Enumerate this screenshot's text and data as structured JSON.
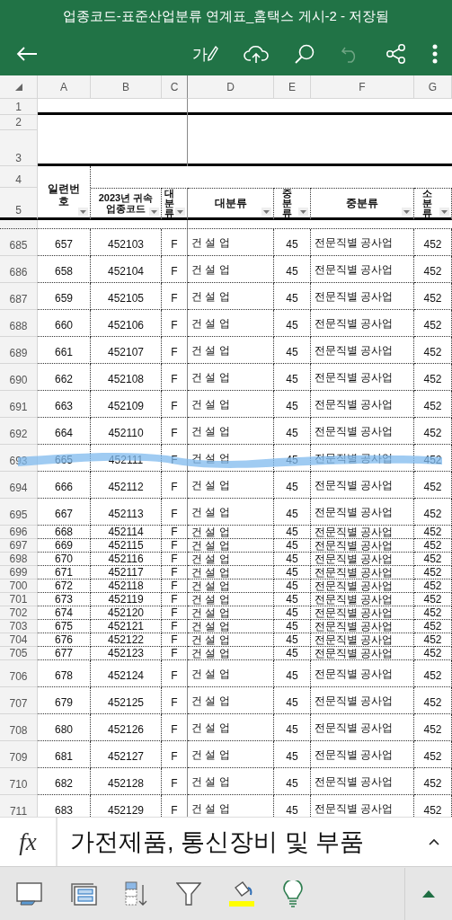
{
  "window": {
    "title": "업종코드-표준산업분류 연계표_홈택스 게시-2 - 저장됨"
  },
  "toolbar": {
    "ink_label": "가",
    "undo_disabled": true
  },
  "columns": [
    "A",
    "B",
    "C",
    "D",
    "E",
    "F",
    "G"
  ],
  "top_rows": [
    "1",
    "2",
    "3"
  ],
  "header_rows": [
    "4",
    "5"
  ],
  "table_headers": [
    {
      "label": "일련번호",
      "kind": "wrap"
    },
    {
      "label": "2023년 귀속 업종코드",
      "kind": "wrap"
    },
    {
      "label": "대분류",
      "kind": "vertical"
    },
    {
      "label": "대분류",
      "kind": "wrap"
    },
    {
      "label": "중분류",
      "kind": "vertical"
    },
    {
      "label": "중분류",
      "kind": "wrap"
    },
    {
      "label": "소분류",
      "kind": "vertical"
    }
  ],
  "rows": [
    {
      "row": "685",
      "kind": "tall",
      "ink_highlight": false,
      "cells": [
        "657",
        "452103",
        "F",
        "건 설 업",
        "45",
        "전문직별 공사업",
        "452"
      ]
    },
    {
      "row": "686",
      "kind": "tall",
      "ink_highlight": false,
      "cells": [
        "658",
        "452104",
        "F",
        "건 설 업",
        "45",
        "전문직별 공사업",
        "452"
      ]
    },
    {
      "row": "687",
      "kind": "tall",
      "ink_highlight": false,
      "cells": [
        "659",
        "452105",
        "F",
        "건 설 업",
        "45",
        "전문직별 공사업",
        "452"
      ]
    },
    {
      "row": "688",
      "kind": "tall",
      "ink_highlight": false,
      "cells": [
        "660",
        "452106",
        "F",
        "건 설 업",
        "45",
        "전문직별 공사업",
        "452"
      ]
    },
    {
      "row": "689",
      "kind": "tall",
      "ink_highlight": false,
      "cells": [
        "661",
        "452107",
        "F",
        "건 설 업",
        "45",
        "전문직별 공사업",
        "452"
      ]
    },
    {
      "row": "690",
      "kind": "tall",
      "ink_highlight": false,
      "cells": [
        "662",
        "452108",
        "F",
        "건 설 업",
        "45",
        "전문직별 공사업",
        "452"
      ]
    },
    {
      "row": "691",
      "kind": "tall",
      "ink_highlight": false,
      "cells": [
        "663",
        "452109",
        "F",
        "건 설 업",
        "45",
        "전문직별 공사업",
        "452"
      ]
    },
    {
      "row": "692",
      "kind": "tall",
      "ink_highlight": false,
      "cells": [
        "664",
        "452110",
        "F",
        "건 설 업",
        "45",
        "전문직별 공사업",
        "452"
      ]
    },
    {
      "row": "693",
      "kind": "tall",
      "ink_highlight": true,
      "cells": [
        "665",
        "452111",
        "F",
        "건 설 업",
        "45",
        "전문직별 공사업",
        "452"
      ]
    },
    {
      "row": "694",
      "kind": "tall",
      "ink_highlight": false,
      "cells": [
        "666",
        "452112",
        "F",
        "건 설 업",
        "45",
        "전문직별 공사업",
        "452"
      ]
    },
    {
      "row": "695",
      "kind": "tall",
      "ink_highlight": false,
      "cells": [
        "667",
        "452113",
        "F",
        "건 설 업",
        "45",
        "전문직별 공사업",
        "452"
      ]
    },
    {
      "row": "696",
      "kind": "short",
      "ink_highlight": false,
      "cells": [
        "668",
        "452114",
        "F",
        "건 설 업",
        "45",
        "전문직별 공사업",
        "452"
      ]
    },
    {
      "row": "697",
      "kind": "short",
      "ink_highlight": false,
      "cells": [
        "669",
        "452115",
        "F",
        "건 설 업",
        "45",
        "전문직별 공사업",
        "452"
      ]
    },
    {
      "row": "698",
      "kind": "short",
      "ink_highlight": false,
      "cells": [
        "670",
        "452116",
        "F",
        "건 설 업",
        "45",
        "전문직별 공사업",
        "452"
      ]
    },
    {
      "row": "699",
      "kind": "short",
      "ink_highlight": false,
      "cells": [
        "671",
        "452117",
        "F",
        "건 설 업",
        "45",
        "전문직별 공사업",
        "452"
      ]
    },
    {
      "row": "700",
      "kind": "short",
      "ink_highlight": false,
      "cells": [
        "672",
        "452118",
        "F",
        "건 설 업",
        "45",
        "전문직별 공사업",
        "452"
      ]
    },
    {
      "row": "701",
      "kind": "short",
      "ink_highlight": false,
      "cells": [
        "673",
        "452119",
        "F",
        "건 설 업",
        "45",
        "전문직별 공사업",
        "452"
      ]
    },
    {
      "row": "702",
      "kind": "short",
      "ink_highlight": false,
      "cells": [
        "674",
        "452120",
        "F",
        "건 설 업",
        "45",
        "전문직별 공사업",
        "452"
      ]
    },
    {
      "row": "703",
      "kind": "short",
      "ink_highlight": false,
      "cells": [
        "675",
        "452121",
        "F",
        "건 설 업",
        "45",
        "전문직별 공사업",
        "452"
      ]
    },
    {
      "row": "704",
      "kind": "short",
      "ink_highlight": false,
      "cells": [
        "676",
        "452122",
        "F",
        "건 설 업",
        "45",
        "전문직별 공사업",
        "452"
      ]
    },
    {
      "row": "705",
      "kind": "short",
      "ink_highlight": false,
      "cells": [
        "677",
        "452123",
        "F",
        "건 설 업",
        "45",
        "전문직별 공사업",
        "452"
      ]
    },
    {
      "row": "706",
      "kind": "tall",
      "ink_highlight": false,
      "cells": [
        "678",
        "452124",
        "F",
        "건 설 업",
        "45",
        "전문직별 공사업",
        "452"
      ]
    },
    {
      "row": "707",
      "kind": "tall",
      "ink_highlight": false,
      "cells": [
        "679",
        "452125",
        "F",
        "건 설 업",
        "45",
        "전문직별 공사업",
        "452"
      ]
    },
    {
      "row": "708",
      "kind": "tall",
      "ink_highlight": false,
      "cells": [
        "680",
        "452126",
        "F",
        "건 설 업",
        "45",
        "전문직별 공사업",
        "452"
      ]
    },
    {
      "row": "709",
      "kind": "tall",
      "ink_highlight": false,
      "cells": [
        "681",
        "452127",
        "F",
        "건 설 업",
        "45",
        "전문직별 공사업",
        "452"
      ]
    },
    {
      "row": "710",
      "kind": "tall",
      "ink_highlight": false,
      "cells": [
        "682",
        "452128",
        "F",
        "건 설 업",
        "45",
        "전문직별 공사업",
        "452"
      ]
    },
    {
      "row": "711",
      "kind": "tall",
      "ink_highlight": false,
      "cells": [
        "683",
        "452129",
        "F",
        "건 설 업",
        "45",
        "전문직별 공사업",
        "452"
      ]
    }
  ],
  "formula_bar": {
    "fx": "fx",
    "value": "가전제품, 통신장비 및 부품"
  }
}
